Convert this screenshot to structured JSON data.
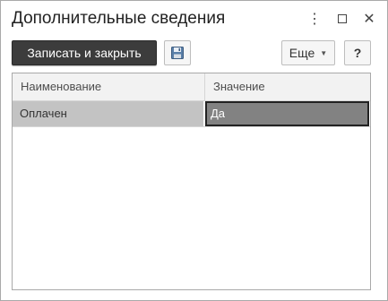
{
  "window": {
    "title": "Дополнительные сведения"
  },
  "titlebar_icons": {
    "more": "more-vertical-icon",
    "maximize": "maximize-icon",
    "close": "close-icon"
  },
  "toolbar": {
    "save_close_label": "Записать и закрыть",
    "save_icon": "floppy-disk-icon",
    "more_label": "Еще",
    "help_label": "?"
  },
  "table": {
    "columns": [
      "Наименование",
      "Значение"
    ],
    "rows": [
      {
        "name": "Оплачен",
        "value": "Да"
      }
    ]
  },
  "colors": {
    "primary_button": "#3c3c3c",
    "selected_row": "#c3c3c3",
    "active_cell": "#828282"
  }
}
